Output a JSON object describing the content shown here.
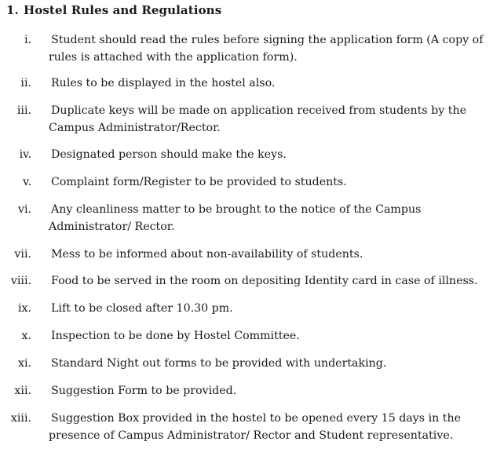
{
  "section": {
    "number": "1.",
    "title": "Hostel Rules and Regulations"
  },
  "rules": [
    {
      "numeral": "i.",
      "text": "Student should read the rules before signing the application form (A copy of rules is attached with the application form)."
    },
    {
      "numeral": "ii.",
      "text": "Rules to be displayed in the hostel also."
    },
    {
      "numeral": "iii.",
      "text": "Duplicate keys will be made on application received from students by the Campus Administrator/Rector."
    },
    {
      "numeral": "iv.",
      "text": "Designated person should make the keys."
    },
    {
      "numeral": "v.",
      "text": "Complaint form/Register to be provided to students."
    },
    {
      "numeral": "vi.",
      "text": "Any cleanliness matter to be brought to the notice of the Campus Administrator/ Rector."
    },
    {
      "numeral": "vii.",
      "text": "Mess to be informed about non-availability of students."
    },
    {
      "numeral": "viii.",
      "text": "Food to be served in the room on depositing Identity card in case of illness."
    },
    {
      "numeral": "ix.",
      "text": "Lift to be closed after 10.30 pm."
    },
    {
      "numeral": "x.",
      "text": "Inspection to be done by Hostel Committee."
    },
    {
      "numeral": "xi.",
      "text": "Standard Night out forms to be provided with undertaking."
    },
    {
      "numeral": "xii.",
      "text": "Suggestion Form to be provided."
    },
    {
      "numeral": "xiii.",
      "text": "Suggestion Box provided in the hostel to be opened every 15 days in the presence of Campus Administrator/ Rector and Student representative."
    }
  ]
}
